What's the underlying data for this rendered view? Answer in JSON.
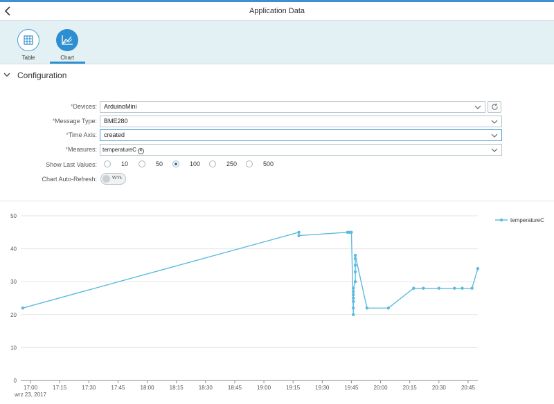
{
  "header": {
    "title": "Application Data"
  },
  "tabs": [
    {
      "label": "Table",
      "icon": "table-icon",
      "selected": false
    },
    {
      "label": "Chart",
      "icon": "line-chart-icon",
      "selected": true
    }
  ],
  "config": {
    "title": "Configuration",
    "fields": {
      "devices": {
        "label": "Devices:",
        "required": true,
        "value": "ArduinoMini"
      },
      "message_type": {
        "label": "Message Type:",
        "required": true,
        "value": "BME280"
      },
      "time_axis": {
        "label": "Time Axis:",
        "required": true,
        "value": "created"
      },
      "measures": {
        "label": "Measures:",
        "required": true,
        "tokens": [
          "temperatureC"
        ]
      }
    },
    "show_last_values": {
      "label": "Show Last Values:",
      "options": [
        "10",
        "50",
        "100",
        "250",
        "500"
      ],
      "selected": "100"
    },
    "auto_refresh": {
      "label": "Chart Auto-Refresh:",
      "state_text": "WYŁ"
    }
  },
  "colors": {
    "accent": "#2d8fd0",
    "series": "#5bbae0",
    "tabbar_bg": "#e3f1f4"
  },
  "chart_data": {
    "type": "line",
    "title": "",
    "xlabel": "",
    "ylabel": "",
    "ylim": [
      0,
      50
    ],
    "yticks": [
      0,
      10,
      20,
      30,
      40,
      50
    ],
    "x_range": [
      "16:55",
      "20:50"
    ],
    "x_tick_labels": [
      "17:00",
      "17:15",
      "17:30",
      "17:45",
      "18:00",
      "18:15",
      "18:30",
      "18:45",
      "19:00",
      "19:15",
      "19:30",
      "19:45",
      "20:00",
      "20:15",
      "20:30",
      "20:45"
    ],
    "x_date_label": "wrz 23, 2017",
    "grid": "horizontal",
    "legend": "top-right",
    "series": [
      {
        "name": "temperatureC",
        "points": [
          [
            "16:56",
            22
          ],
          [
            "19:18",
            45
          ],
          [
            "19:18",
            44
          ],
          [
            "19:43",
            45
          ],
          [
            "19:44",
            45
          ],
          [
            "19:45",
            45
          ],
          [
            "19:46",
            20
          ],
          [
            "19:46",
            22
          ],
          [
            "19:46",
            24
          ],
          [
            "19:46",
            25
          ],
          [
            "19:46",
            26
          ],
          [
            "19:46",
            27
          ],
          [
            "19:46",
            28
          ],
          [
            "19:47",
            30
          ],
          [
            "19:47",
            33
          ],
          [
            "19:47",
            35
          ],
          [
            "19:47",
            37
          ],
          [
            "19:47",
            38
          ],
          [
            "19:53",
            22
          ],
          [
            "20:04",
            22
          ],
          [
            "20:17",
            28
          ],
          [
            "20:22",
            28
          ],
          [
            "20:30",
            28
          ],
          [
            "20:38",
            28
          ],
          [
            "20:42",
            28
          ],
          [
            "20:47",
            28
          ],
          [
            "20:50",
            34
          ]
        ]
      }
    ]
  }
}
